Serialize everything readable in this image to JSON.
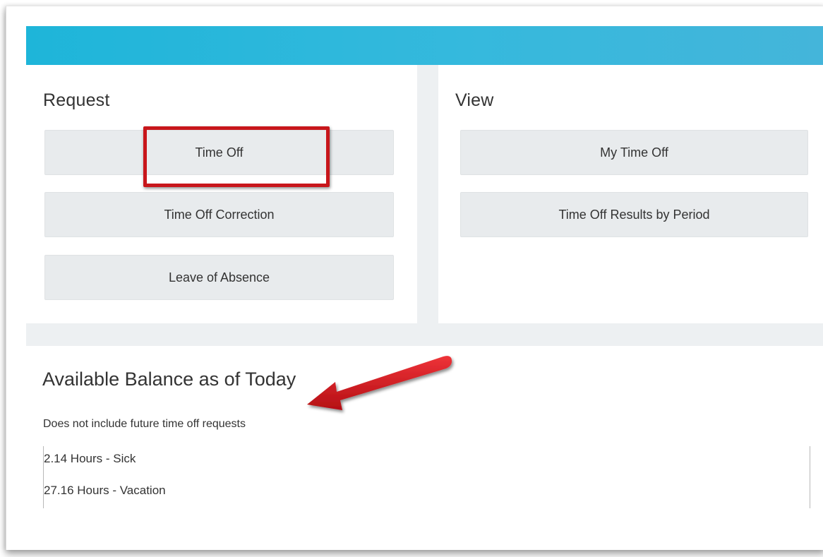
{
  "request": {
    "title": "Request",
    "buttons": [
      "Time Off",
      "Time Off Correction",
      "Leave of Absence"
    ]
  },
  "view": {
    "title": "View",
    "buttons": [
      "My Time Off",
      "Time Off Results by Period"
    ]
  },
  "balance": {
    "title": "Available Balance as of Today",
    "note": "Does not include future time off requests",
    "items": [
      "2.14 Hours - Sick",
      "27.16 Hours - Vacation"
    ]
  },
  "colors": {
    "banner": "#2cb7db",
    "annotation_red": "#c8161b"
  },
  "annotations": {
    "highlight_target": "Time Off",
    "arrow_target": "Available Balance as of Today"
  }
}
